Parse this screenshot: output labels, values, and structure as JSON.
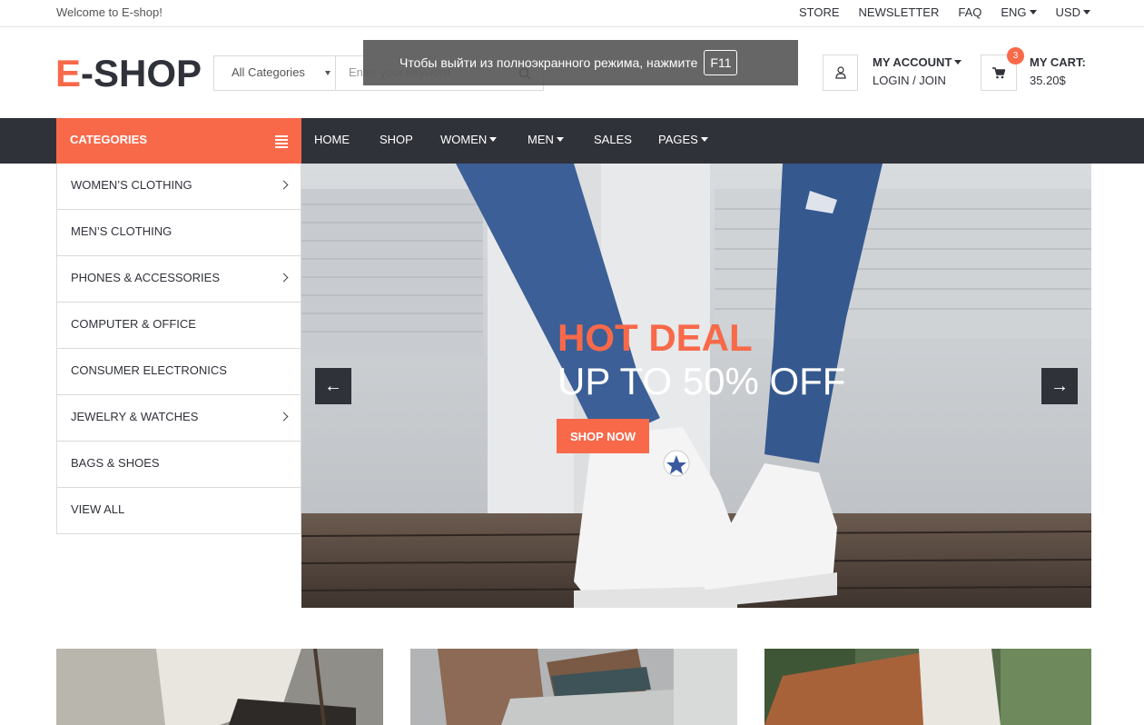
{
  "topbar": {
    "welcome": "Welcome to E-shop!",
    "links": [
      "STORE",
      "NEWSLETTER",
      "FAQ"
    ],
    "language": "ENG",
    "currency": "USD"
  },
  "header": {
    "logo_accent": "E",
    "logo_rest": "-SHOP",
    "search_category": "All Categories",
    "search_placeholder": "Enter your keyword",
    "account_title": "MY ACCOUNT",
    "account_login": "LOGIN / JOIN",
    "cart_title": "MY CART:",
    "cart_total": "35.20$",
    "cart_count": "3"
  },
  "fullscreen_notice": {
    "text": "Чтобы выйти из полноэкранного режима, нажмите",
    "key": "F11"
  },
  "nav": {
    "categories_label": "CATEGORIES",
    "links": [
      {
        "label": "HOME",
        "dropdown": false
      },
      {
        "label": "SHOP",
        "dropdown": false
      },
      {
        "label": "WOMEN",
        "dropdown": true
      },
      {
        "label": "MEN",
        "dropdown": true
      },
      {
        "label": "SALES",
        "dropdown": false
      },
      {
        "label": "PAGES",
        "dropdown": true
      }
    ]
  },
  "categories": [
    {
      "label": "WOMEN’S CLOTHING",
      "has_sub": true
    },
    {
      "label": "MEN’S CLOTHING",
      "has_sub": false
    },
    {
      "label": "PHONES & ACCESSORIES",
      "has_sub": true
    },
    {
      "label": "COMPUTER & OFFICE",
      "has_sub": false
    },
    {
      "label": "CONSUMER ELECTRONICS",
      "has_sub": false
    },
    {
      "label": "JEWELRY & WATCHES",
      "has_sub": true
    },
    {
      "label": "BAGS & SHOES",
      "has_sub": false
    },
    {
      "label": "VIEW ALL",
      "has_sub": false
    }
  ],
  "hero": {
    "headline": "HOT DEAL",
    "subheadline": "UP TO 50% OFF",
    "cta": "SHOP NOW"
  },
  "colors": {
    "accent": "#f8694a",
    "dark": "#30323a"
  }
}
